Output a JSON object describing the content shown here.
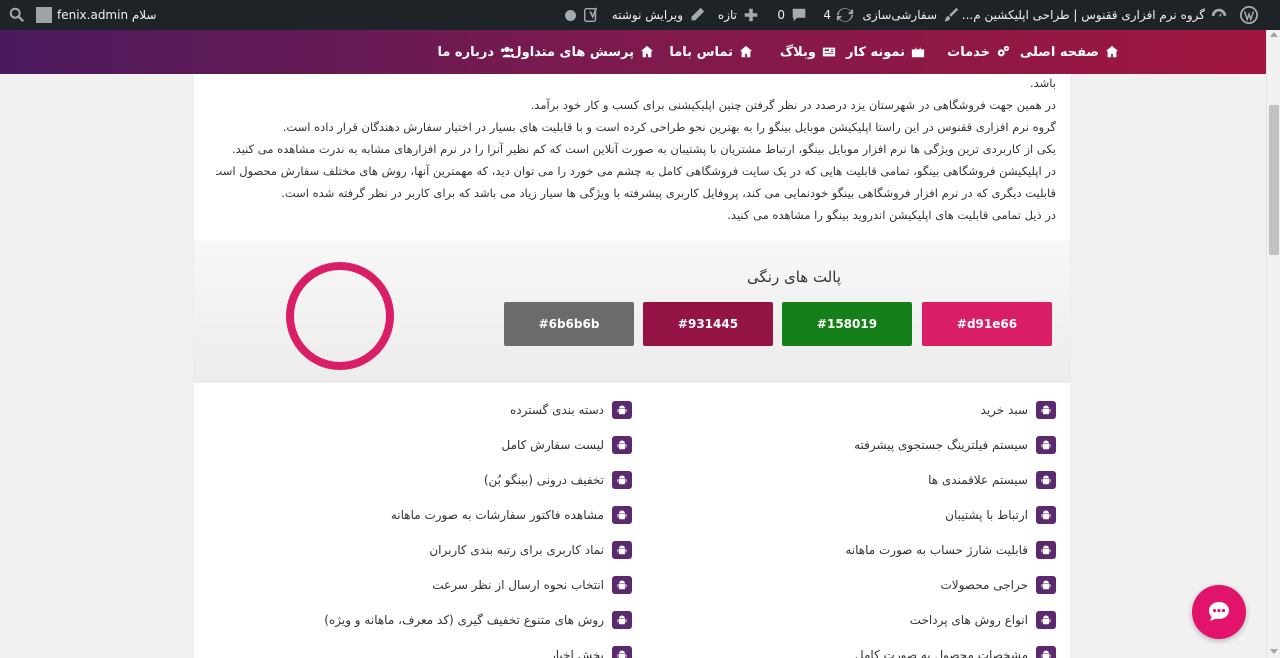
{
  "adminbar": {
    "wp_logo": "wordpress-icon",
    "site_name": "گروه نرم افزاری ققنوس | طراحی اپلیکشین م...",
    "customize": "سفارشی‌سازی",
    "updates_count": "4",
    "comments_count": "0",
    "new_label": "تازه",
    "edit_label": "ویرایش نوشته",
    "greeting": "سلام fenix.admin",
    "search_icon": "search-icon"
  },
  "nav": {
    "items": [
      {
        "label": "صفحه اصلی",
        "icon": "home-icon"
      },
      {
        "label": "خدمات",
        "icon": "gears-icon"
      },
      {
        "label": "نمونه کار",
        "icon": "briefcase-icon"
      },
      {
        "label": "وبلاگ",
        "icon": "newspaper-icon"
      },
      {
        "label": "تماس باما",
        "icon": "home-icon"
      },
      {
        "label": "پرسش های متداول",
        "icon": "home-icon"
      },
      {
        "label": "درباره ما",
        "icon": "users-icon"
      }
    ]
  },
  "content": {
    "paragraphs": [
      "باشد.",
      "در همین جهت فروشگاهی در شهرستان یزد درصدد در نظر گرفتن چنین اپلیکیشنی برای کسب و کار خود برآمد.",
      "گروه نرم افزاری ققنوس در این راستا اپلیکیشن موبایل بینگو را به بهترین نحو طراحی کرده است و با قابلیت های بسیار در اختیار سفارش دهندگان قرار داده است.",
      "یکی از کاربردی ترین ویژگی ها نرم افزار موبایل بینگو، ارتباط مشتریان با پشتیبان به صورت آنلاین است که کم نظیر آنرا را در نرم افزارهای مشابه به ندرت مشاهده می کنید.",
      "در اپلیکیشن فروشگاهی بینگو، تمامی قابلیت هایی که در یک سایت فروشگاهی کامل به چشم می خورد را می توان دید، که مهمترین آنها، روش های مختلف سفارش محصول است.",
      "قابلیت دیگری که در نرم افزار فروشگاهی بینگو خودنمایی می کند، پروفایل کاربری پیشرفته با ویژگی ها سیار زیاد می باشد که برای کاربر در نظر گرفته شده است.",
      "در ذیل تمامی قابلیت های اپلیکیشن اندروید بینگو را مشاهده می کنید."
    ]
  },
  "palette": {
    "title": "پالت های رنگی",
    "colors": [
      "#d91e66",
      "#158019",
      "#931445",
      "#6b6b6b"
    ],
    "ring_color": "#d91e66"
  },
  "features": {
    "right": [
      "سبد خرید",
      "سیستم فیلترینگ جستجوی پیشرفته",
      "سیستم علاقمندی ها",
      "ارتباط با پشتیبان",
      "قابلیت شارژ حساب به صورت ماهانه",
      "حراجی محصولات",
      "انواع روش های پرداخت",
      "مشخصات محصول به صورت کامل"
    ],
    "left": [
      "دسته بندی گسترده",
      "لیست سفارش کامل",
      "تخفیف درونی (بینگو بُن)",
      "مشاهده فاکتور سفارشات به صورت ماهانه",
      "نماد کاربری برای رتبه بندی کاربران",
      "انتخاب نحوه ارسال از نظر سرعت",
      "روش های متنوع تخفیف گیری (کد معرف، ماهانه و ویژه)",
      "بخش اخبار"
    ]
  },
  "chat": {
    "icon": "chat-bubble-icon",
    "color": "#e1136b"
  }
}
